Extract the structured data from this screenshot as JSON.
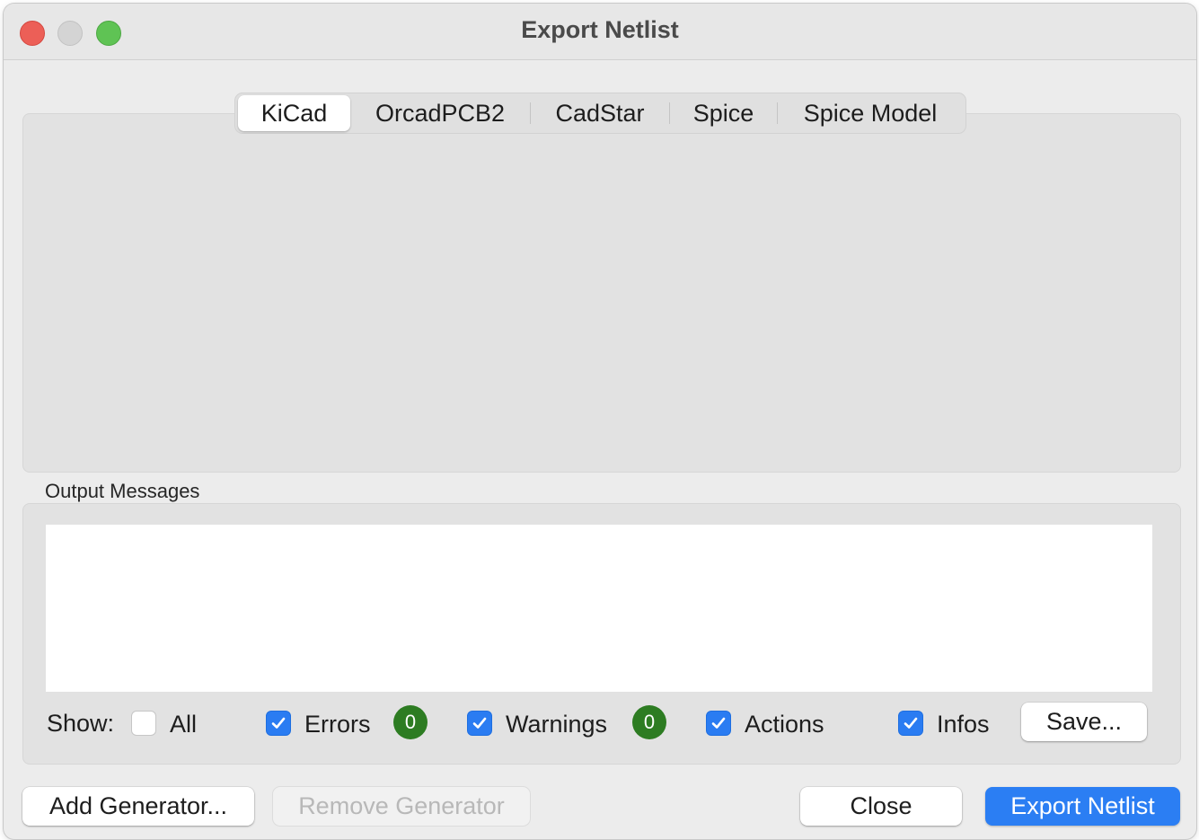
{
  "window": {
    "title": "Export Netlist"
  },
  "tabs": [
    {
      "label": "KiCad",
      "active": true
    },
    {
      "label": "OrcadPCB2",
      "active": false
    },
    {
      "label": "CadStar",
      "active": false
    },
    {
      "label": "Spice",
      "active": false
    },
    {
      "label": "Spice Model",
      "active": false
    }
  ],
  "output": {
    "label": "Output Messages",
    "show_label": "Show:",
    "filters": {
      "all": {
        "label": "All",
        "checked": false
      },
      "errors": {
        "label": "Errors",
        "checked": true,
        "count": "0"
      },
      "warnings": {
        "label": "Warnings",
        "checked": true,
        "count": "0"
      },
      "actions": {
        "label": "Actions",
        "checked": true
      },
      "infos": {
        "label": "Infos",
        "checked": true
      }
    },
    "save_label": "Save..."
  },
  "buttons": {
    "add_generator": "Add Generator...",
    "remove_generator": "Remove Generator",
    "close": "Close",
    "export": "Export Netlist"
  },
  "colors": {
    "accent": "#2b7ef3",
    "badge": "#2d7c22",
    "traffic_close": "#ec5f57",
    "traffic_max": "#5fc354"
  }
}
